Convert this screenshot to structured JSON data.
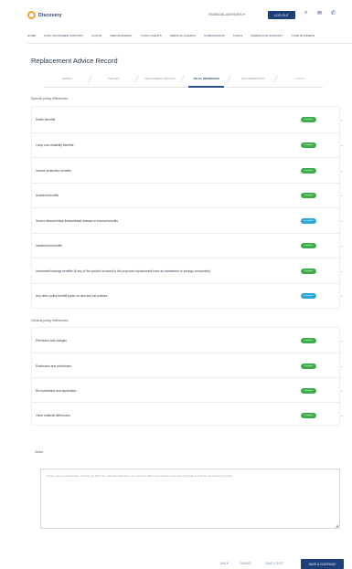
{
  "header": {
    "logo_text": "Discovery",
    "account_select": "FINANCIAL ADVISORS ▾",
    "new_button": "LOG OUT",
    "icons": [
      "search-icon",
      "mail-icon",
      "phone-icon"
    ]
  },
  "nav": {
    "items": [
      "HOME",
      "FIND CONSUMER SUPPORT",
      "QUOTE",
      "NEW BUSINESS",
      "YOUR CLIENTS",
      "SERVICE CLIENTS",
      "COMMISSIONS",
      "TOOLS",
      "MARKETING SUPPORT",
      "YOUR BUSINESS"
    ]
  },
  "page": {
    "title": "Replacement Advice Record"
  },
  "steps": [
    {
      "label": "DETAILS",
      "state": "done"
    },
    {
      "label": "POLICIES",
      "state": "done"
    },
    {
      "label": "REPLACEMENT REASONS",
      "state": "done"
    },
    {
      "label": "POLICY DIFFERENCES",
      "state": "active"
    },
    {
      "label": "RECOMMENDATION",
      "state": "pending"
    },
    {
      "label": "CONFIRM",
      "state": "upcoming"
    }
  ],
  "specific": {
    "heading": "Specific policy differences",
    "rows": [
      {
        "label": "Death benefits",
        "status": "Complete",
        "color": "#3fae49"
      },
      {
        "label": "Lump sum disability benefits",
        "status": "Complete",
        "color": "#3fae49"
      },
      {
        "label": "Income protection benefits",
        "status": "Complete",
        "color": "#3fae49"
      },
      {
        "label": "Accident benefits",
        "status": "Complete",
        "color": "#3fae49"
      },
      {
        "label": "Severe illness/critical illness/dread disease or trauma benefits",
        "status": "Incomplete",
        "color": "#2aa6d8"
      },
      {
        "label": "Impairment benefits",
        "status": "Complete",
        "color": "#3fae49"
      },
      {
        "label": "Investment/savings benefits (if any of the policies involved in the proposed replacement have an investment or savings component)",
        "status": "Complete",
        "color": "#3fae49"
      },
      {
        "label": "Any other policy benefit types on new and old policies",
        "status": "Incomplete",
        "color": "#2aa6d8"
      }
    ]
  },
  "general": {
    "heading": "General policy differences",
    "rows": [
      {
        "label": "Premiums and charges",
        "status": "Complete",
        "color": "#3fae49"
      },
      {
        "label": "Exclusions and restrictions",
        "status": "Complete",
        "color": "#3fae49"
      },
      {
        "label": "Re-investment and duplication",
        "status": "Complete",
        "color": "#3fae49"
      },
      {
        "label": "Other material differences",
        "status": "Complete",
        "color": "#3fae49"
      }
    ]
  },
  "notes": {
    "label": "Notes",
    "placeholder": "Please give an explanation of what you think the material implications are of these differences between the financial product and the replacement product"
  },
  "footer": {
    "links": [
      "BACK",
      "CANCEL",
      "SAVE & EXIT"
    ],
    "primary": "SAVE & CONTINUE"
  }
}
